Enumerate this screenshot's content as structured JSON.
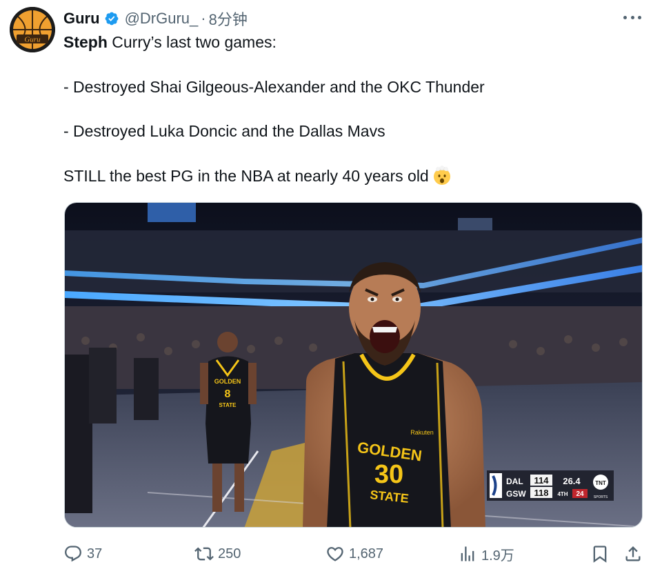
{
  "author": {
    "display_name": "Guru",
    "handle": "@DrGuru_",
    "separator": "·",
    "time": "8分钟",
    "avatar_text": "Guru"
  },
  "tweet": {
    "lead_bold": "Steph",
    "lead_rest": " Curry’s last two games:",
    "line2": "- Destroyed Shai Gilgeous-Alexander and the OKC Thunder",
    "line3": "- Destroyed Luka Doncic and the Dallas Mavs",
    "line4": "STILL the best PG in the NBA at nearly 40 years old",
    "emoji": "exploding-head-emoji"
  },
  "media": {
    "jersey_front": "GOLDEN",
    "jersey_number": "30",
    "jersey_bottom": "STATE",
    "jersey_sponsor": "Rakuten",
    "teammate_number": "8",
    "teammate_front": "GOLDEN",
    "teammate_bottom": "STATE",
    "scorebug": {
      "team1": "DAL",
      "score1": "114",
      "team2": "GSW",
      "score2": "118",
      "clock": "26.4",
      "quarter": "4TH",
      "shot_clock": "24",
      "network": "TNT",
      "network_sub": "SPORTS"
    }
  },
  "actions": {
    "replies": "37",
    "retweets": "250",
    "likes": "1,687",
    "views": "1.9万"
  },
  "colors": {
    "text": "#0f1419",
    "secondary": "#536471",
    "verified": "#1d9bf0",
    "warriors_gold": "#f5c518",
    "jersey_black": "#15161c"
  }
}
